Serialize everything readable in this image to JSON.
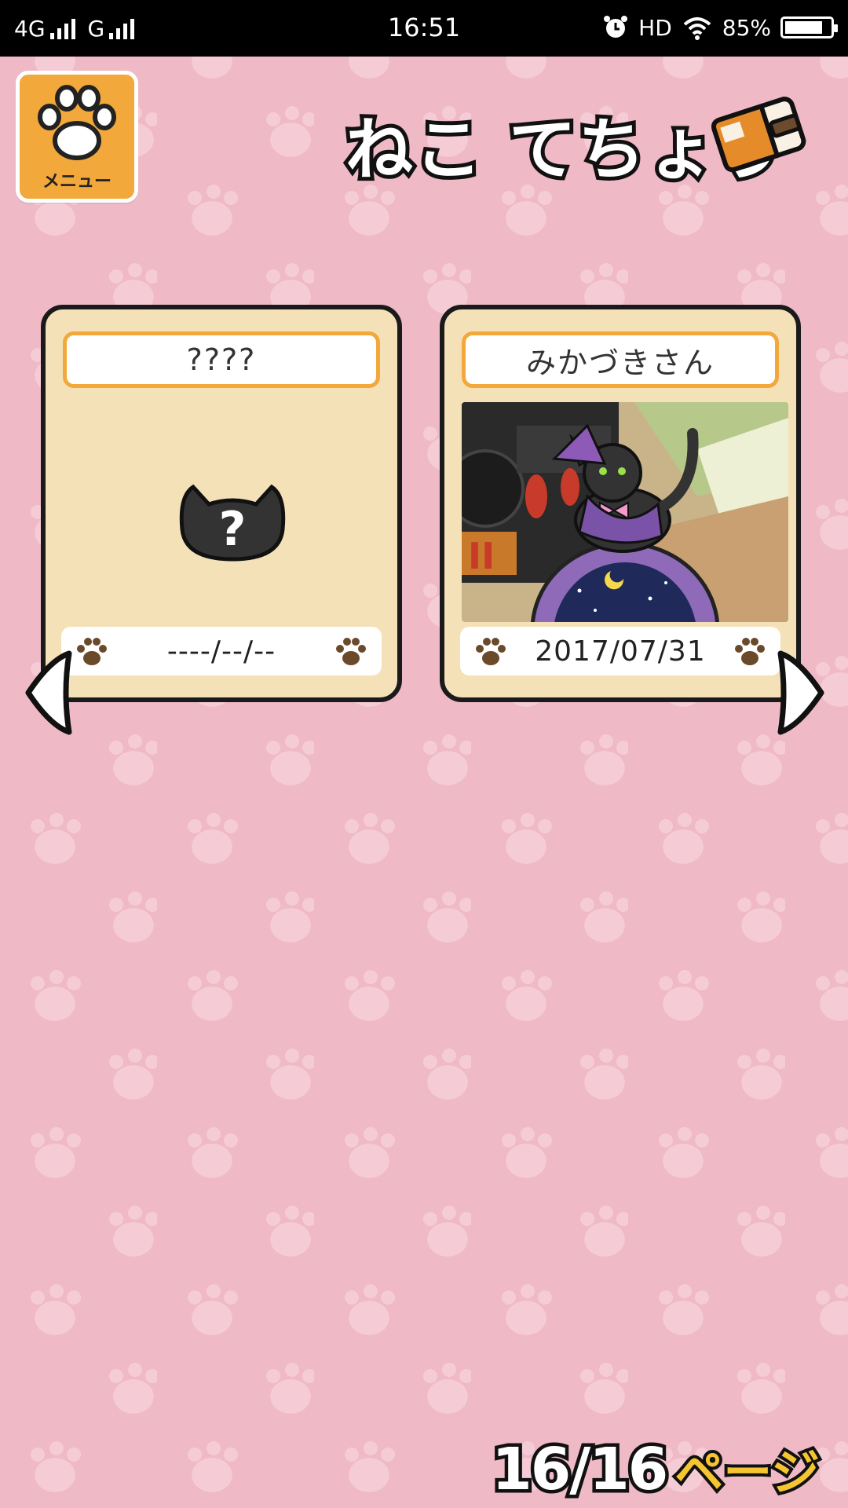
{
  "status_bar": {
    "network_1": "4G",
    "network_2": "G",
    "time": "16:51",
    "hd": "HD",
    "battery": "85%",
    "battery_level": 0.85,
    "icons": [
      "signal-icon",
      "alarm-icon",
      "wifi-icon",
      "battery-icon"
    ]
  },
  "header": {
    "menu_label": "メニュー",
    "title": "ねこ てちょう",
    "icons": [
      "paw-icon",
      "notebook-icon"
    ],
    "colors": {
      "menu_bg": "#f2a83b",
      "title_fill": "#ffffff",
      "outline": "#111111"
    }
  },
  "cards": [
    {
      "name": "????",
      "date": "----/--/--",
      "discovered": false
    },
    {
      "name": "みかづきさん",
      "date": "2017/07/31",
      "discovered": true
    }
  ],
  "navigation": {
    "prev_icon": "arrow-left-icon",
    "next_icon": "arrow-right-icon"
  },
  "page": {
    "current_total": "16/16",
    "suffix": "ページ"
  },
  "colors": {
    "background": "#efb9c6",
    "card": "#f4e1b8",
    "plate_border": "#f2a83b",
    "page_suffix": "#f5c531"
  }
}
